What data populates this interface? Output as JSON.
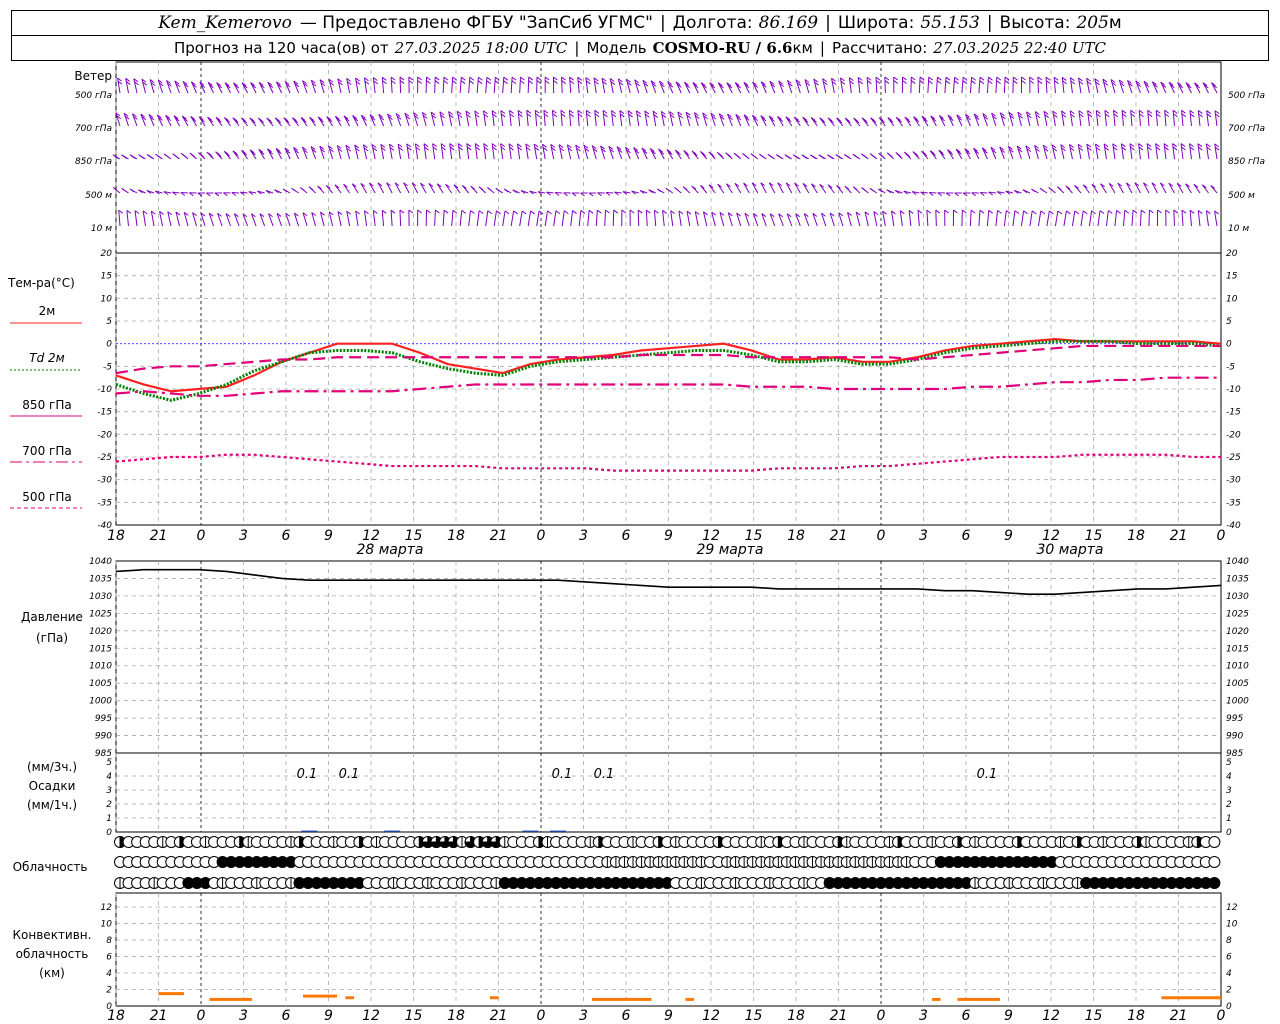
{
  "header": {
    "station": "Kem_Kemerovo",
    "provided_by": "— Предоставлено ФГБУ \"ЗапСиб УГМС\"",
    "lon_label": "Долгота:",
    "lon": "86.169",
    "lat_label": "Широта:",
    "lat": "55.153",
    "alt_label": "Высота:",
    "alt": "205",
    "alt_unit": "м",
    "forecast_prefix": "Прогноз на 120 часа(ов) от",
    "forecast_start": "27.03.2025 18:00 UTC",
    "model_label": "Модель",
    "model": "COSMO-RU / 6.6",
    "model_unit": "км",
    "calc_label": "Рассчитано:",
    "calc_time": "27.03.2025 22:40 UTC"
  },
  "wind_panel": {
    "title": "Ветер",
    "levels": [
      "500 гПа",
      "700 гПа",
      "850 гПа",
      "500 м",
      "10 м"
    ],
    "right_levels": [
      "500 гПа",
      "700 гПа",
      "850 гПа",
      "500 м",
      "10 м"
    ]
  },
  "temp_panel": {
    "title": "Тем-ра(°С)",
    "legend": [
      {
        "label": "2м",
        "color": "#ff2020",
        "style": "solid"
      },
      {
        "label": "Td 2м",
        "color": "#008000",
        "style": "dotted"
      },
      {
        "label": "850 гПа",
        "color": "#e0007a",
        "style": "dashed"
      },
      {
        "label": "700 гПа",
        "color": "#e0007a",
        "style": "dashdot"
      },
      {
        "label": "500 гПа",
        "color": "#e0007a",
        "style": "dotted"
      }
    ]
  },
  "pressure_panel": {
    "title": "Давление",
    "unit": "(гПа)"
  },
  "precip_panel": {
    "unit_top": "(мм/3ч.)",
    "title": "Осадки",
    "unit_bottom": "(мм/1ч.)",
    "labels": [
      "0.1",
      "0.1",
      "0.1",
      "0.1",
      "0.1"
    ]
  },
  "cloud_panel": {
    "title": "Облачность"
  },
  "conv_panel": {
    "title_lines": [
      "Конвективн.",
      "облачность",
      "(км)"
    ]
  },
  "x_axis": {
    "hour_labels": [
      "18",
      "21",
      "0",
      "3",
      "6",
      "9",
      "12",
      "15",
      "18",
      "21",
      "0",
      "3",
      "6",
      "9",
      "12",
      "15",
      "18",
      "21",
      "0",
      "3",
      "6",
      "9",
      "12",
      "15",
      "18",
      "21",
      "0"
    ],
    "day_labels": [
      "28 марта",
      "29 марта",
      "30 марта"
    ]
  },
  "colors": {
    "wind": "#8000c0",
    "t2m": "#ff2020",
    "td2m": "#008000",
    "upper": "#e0007a",
    "zero_line": "#3030ff",
    "pressure": "#000000",
    "precip": "#1a40a0",
    "conv": "#ff7800",
    "grid": "#aaaaaa"
  },
  "chart_data": [
    {
      "type": "line",
      "title": "Тем-ра(°С)",
      "ylim": [
        -40,
        20
      ],
      "x_hours": [
        0,
        3,
        6,
        9,
        12,
        15,
        18,
        21,
        24,
        27,
        30,
        33,
        36,
        39,
        42,
        45,
        48,
        51,
        54,
        57,
        60,
        63,
        66,
        69,
        72,
        75,
        78,
        81,
        84,
        87,
        90,
        93,
        96,
        99,
        102,
        105,
        108,
        111,
        114,
        117,
        120
      ],
      "series": [
        {
          "name": "2м",
          "values": [
            -7,
            -9,
            -10.5,
            -10,
            -9.5,
            -7,
            -4,
            -2,
            0,
            0,
            0,
            -2,
            -4.5,
            -5.5,
            -6.5,
            -4.5,
            -3.5,
            -3,
            -2.5,
            -1.5,
            -1,
            -0.5,
            0,
            -1.5,
            -3.5,
            -3.5,
            -3,
            -4,
            -4,
            -3,
            -1.5,
            -0.5,
            0,
            0.5,
            1,
            0.5,
            0.5,
            0.5,
            0.5,
            0.5,
            0
          ]
        },
        {
          "name": "Td 2м",
          "values": [
            -9,
            -11,
            -12.5,
            -11,
            -9,
            -6,
            -4,
            -2,
            -1.5,
            -1.5,
            -2,
            -4,
            -5.5,
            -6.5,
            -7,
            -5,
            -4,
            -3.5,
            -3,
            -2.5,
            -2,
            -1.5,
            -1.5,
            -2.5,
            -4,
            -4,
            -3.5,
            -4.5,
            -4.5,
            -3.5,
            -2,
            -1,
            -0.5,
            0,
            0.5,
            0.5,
            0.5,
            0,
            0,
            0,
            -0.5
          ]
        },
        {
          "name": "850 гПа",
          "values": [
            -6.5,
            -5.5,
            -5,
            -5,
            -4.5,
            -4,
            -3.5,
            -3.5,
            -3,
            -3,
            -3,
            -3,
            -3,
            -3,
            -3,
            -3,
            -3,
            -3,
            -3,
            -2.5,
            -2.5,
            -2.5,
            -2.5,
            -3,
            -3,
            -3,
            -3,
            -3,
            -3,
            -3.5,
            -3,
            -2.5,
            -2,
            -1.5,
            -1,
            -0.5,
            -0.5,
            -0.5,
            -0.5,
            -0.5,
            -0.5
          ]
        },
        {
          "name": "700 гПа",
          "values": [
            -11,
            -10.5,
            -11,
            -11.5,
            -11.5,
            -11,
            -10.5,
            -10.5,
            -10.5,
            -10.5,
            -10.5,
            -10,
            -9.5,
            -9,
            -9,
            -9,
            -9,
            -9,
            -9,
            -9,
            -9,
            -9,
            -9,
            -9.5,
            -9.5,
            -9.5,
            -10,
            -10,
            -10,
            -10,
            -10,
            -9.5,
            -9.5,
            -9,
            -8.5,
            -8.5,
            -8,
            -8,
            -7.5,
            -7.5,
            -7.5
          ]
        },
        {
          "name": "500 гПа",
          "values": [
            -26,
            -25.5,
            -25,
            -25,
            -24.5,
            -24.5,
            -25,
            -25.5,
            -26,
            -26.5,
            -27,
            -27,
            -27,
            -27,
            -27.5,
            -27.5,
            -27.5,
            -27.5,
            -28,
            -28,
            -28,
            -28,
            -28,
            -28,
            -27.5,
            -27.5,
            -27.5,
            -27,
            -27,
            -26.5,
            -26,
            -25.5,
            -25,
            -25,
            -25,
            -24.5,
            -24.5,
            -24.5,
            -24.5,
            -25,
            -25
          ]
        }
      ]
    },
    {
      "type": "line",
      "title": "Давление",
      "ylim": [
        985,
        1040
      ],
      "x_hours": [
        0,
        3,
        6,
        9,
        12,
        15,
        18,
        21,
        24,
        27,
        30,
        33,
        36,
        39,
        42,
        45,
        48,
        51,
        54,
        57,
        60,
        63,
        66,
        69,
        72,
        75,
        78,
        81,
        84,
        87,
        90,
        93,
        96,
        99,
        102,
        105,
        108,
        111,
        114,
        117,
        120
      ],
      "series": [
        {
          "name": "Давление",
          "values": [
            1037,
            1037.5,
            1037.5,
            1037.5,
            1037,
            1036,
            1035,
            1034.5,
            1034.5,
            1034.5,
            1034.5,
            1034.5,
            1034.5,
            1034.5,
            1034.5,
            1034.5,
            1034.5,
            1034,
            1033.5,
            1033,
            1032.5,
            1032.5,
            1032.5,
            1032.5,
            1032,
            1032,
            1032,
            1032,
            1032,
            1032,
            1031.5,
            1031.5,
            1031,
            1030.5,
            1030.5,
            1031,
            1031.5,
            1032,
            1032,
            1032.5,
            1033
          ]
        }
      ]
    },
    {
      "type": "bar",
      "title": "Осадки",
      "ylim": [
        0,
        5
      ],
      "x_hours": [
        21,
        30,
        45,
        48
      ],
      "values": [
        0.1,
        0.1,
        0.1,
        0.1
      ]
    },
    {
      "type": "bar",
      "title": "Конвективн. облачность (км)",
      "ylim": [
        0,
        12
      ],
      "ranges": [
        {
          "from": 5,
          "to": 8,
          "value": 1.5
        },
        {
          "from": 11,
          "to": 16,
          "value": 0.8
        },
        {
          "from": 22,
          "to": 26,
          "value": 1.2
        },
        {
          "from": 27,
          "to": 28,
          "value": 1.0
        },
        {
          "from": 44,
          "to": 45,
          "value": 1.0
        },
        {
          "from": 56,
          "to": 63,
          "value": 0.8
        },
        {
          "from": 67,
          "to": 68,
          "value": 0.8
        },
        {
          "from": 96,
          "to": 97,
          "value": 0.8
        },
        {
          "from": 99,
          "to": 104,
          "value": 0.8
        },
        {
          "from": 123,
          "to": 130,
          "value": 1.0
        }
      ]
    }
  ]
}
